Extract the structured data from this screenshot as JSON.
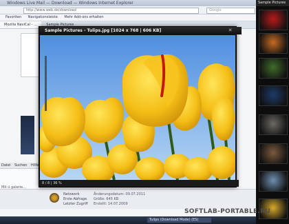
{
  "browser": {
    "title": "Windows Live Mail — Download — Windows Internet Explorer",
    "address": "http://www.web.de/download",
    "search_placeholder": "Google",
    "favorites": [
      "Favoriten",
      "Navigationsleiste",
      "Mehr Add-ons erhalten"
    ],
    "tabs": [
      "Mozilla NaviCal - ...",
      "Sample Pictures"
    ]
  },
  "menu": {
    "items": [
      "Datei",
      "Suchen",
      "Hilfe"
    ]
  },
  "left_panel": {
    "label": "Mit ü galerie..."
  },
  "status": {
    "line1": "Netzwerk",
    "line2": "Erste Abfrage",
    "line3": "Letzter Zugriff",
    "detail1": "Änderungsdatum: 09.07.2011",
    "detail2": "Größe: 645 KB",
    "detail3": "Erstellt: 14.07.2009"
  },
  "taskbar": {
    "item": "Tulips (Download Mode) (ES)"
  },
  "viewer": {
    "title": "Sample Pictures - Tulips.jpg",
    "meta": "[1024 x 768 | 606 KB]",
    "status": "8 / 8    |    36 %"
  },
  "filmstrip": {
    "header": "Sample Pictures",
    "thumbnails": [
      {
        "name": "tulips-red-thumb",
        "color": "#b81a1a"
      },
      {
        "name": "desert-thumb",
        "color": "#c66b22"
      },
      {
        "name": "hydrangea-thumb",
        "color": "#3f6b2a"
      },
      {
        "name": "jellyfish-thumb",
        "color": "#1d3b6a"
      },
      {
        "name": "koala-thumb",
        "color": "#6c6a63"
      },
      {
        "name": "lighthouse-thumb",
        "color": "#7b5a3d"
      },
      {
        "name": "penguins-thumb",
        "color": "#6f8fb0"
      },
      {
        "name": "tulips-yellow-thumb",
        "color": "#d8a92a"
      }
    ]
  },
  "watermark": "SOFTLAB-PORTABLE.RU"
}
